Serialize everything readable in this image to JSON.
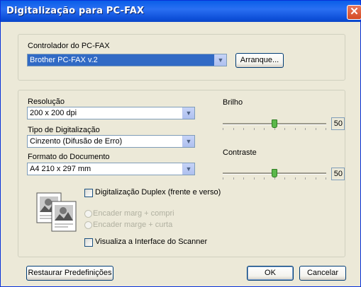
{
  "window": {
    "title": "Digitalização para PC-FAX",
    "close_glyph": "✕"
  },
  "controller": {
    "label": "Controlador do PC-FAX",
    "selected": "Brother PC-FAX v.2",
    "start_button": "Arranque..."
  },
  "resolution": {
    "label": "Resolução",
    "selected": "200 x 200 dpi"
  },
  "scan_type": {
    "label": "Tipo de Digitalização",
    "selected": "Cinzento (Difusão de Erro)"
  },
  "doc_size": {
    "label": "Formato do Documento",
    "selected": "A4 210 x 297 mm"
  },
  "brightness": {
    "label": "Brilho",
    "value": "50",
    "level": 50
  },
  "contrast": {
    "label": "Contraste",
    "value": "50",
    "level": 50
  },
  "duplex": {
    "label": "Digitalização Duplex (frente e verso)",
    "checked": false,
    "options": [
      "Encader marg + compri",
      "Encader marge + curta"
    ],
    "icon": "duplex-pages-icon"
  },
  "scanner_ui": {
    "label": "Visualiza a Interface do Scanner",
    "checked": false
  },
  "footer": {
    "restore_button": "Restaurar Predefinições",
    "ok_button": "OK",
    "cancel_button": "Cancelar"
  },
  "colors": {
    "titlebar": "#0a5ee8",
    "dialog_bg": "#ece9d8",
    "selection": "#316ac5",
    "close": "#d44a24"
  }
}
